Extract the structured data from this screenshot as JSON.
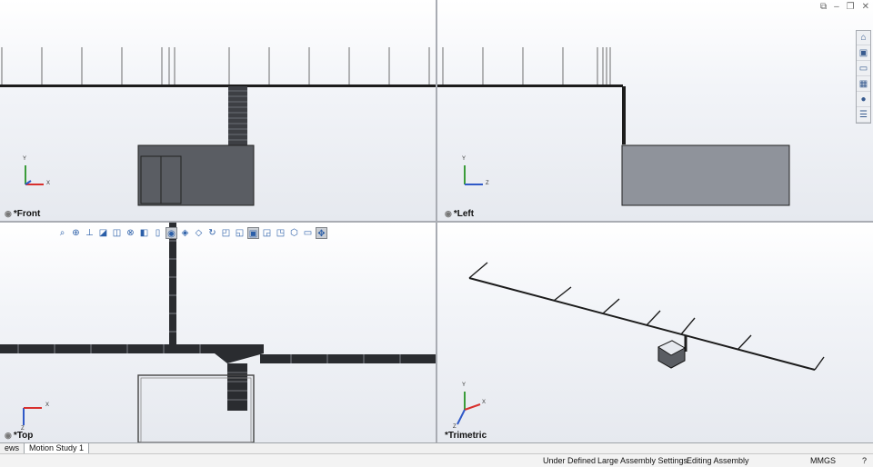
{
  "window": {
    "controls": [
      "⧉",
      "–",
      "❐",
      "✕"
    ]
  },
  "heads_up_toolbar": {
    "icons": [
      "zoom-to-fit-icon",
      "zoom-to-area-icon",
      "previous-view-icon",
      "section-view-icon",
      "dynamic-annotation-icon",
      "view-orientation-icon",
      "display-style-icon",
      "hide-show-items-icon",
      "edit-appearance-icon",
      "apply-scene-icon",
      "rotate-icon",
      "front-view-icon",
      "right-view-icon",
      "single-view-icon",
      "two-view-icon",
      "four-view-icon",
      "isometric-icon",
      "display-pane-icon",
      "link-views-icon"
    ]
  },
  "viewports": {
    "front": {
      "label": "*Front"
    },
    "left": {
      "label": "*Left"
    },
    "top": {
      "label": "*Top"
    },
    "trimetric": {
      "label": "*Trimetric"
    }
  },
  "axis_labels": {
    "x": "X",
    "y": "Y",
    "z": "Z"
  },
  "task_pane": {
    "tabs": [
      "home-icon",
      "parts-icon",
      "file-explorer-icon",
      "view-palette-icon",
      "appearances-icon",
      "custom-properties-icon"
    ]
  },
  "bottom_tabs": [
    {
      "label": "ews",
      "active": false
    },
    {
      "label": "Motion Study 1",
      "active": true
    }
  ],
  "status_bar": {
    "under_defined": "Under Defined",
    "large_assembly": "Large Assembly Settings",
    "editing": "Editing Assembly",
    "units": "MMGS",
    "help_icon": "?"
  },
  "colors": {
    "viewport_bg_top": "#ffffff",
    "viewport_bg_bottom": "#e6e9ef",
    "box_dark": "#5a5d63",
    "box_light": "#8f939b",
    "axis_x": "#d8302e",
    "axis_y": "#3b9c3a",
    "axis_z": "#2f59c7"
  }
}
